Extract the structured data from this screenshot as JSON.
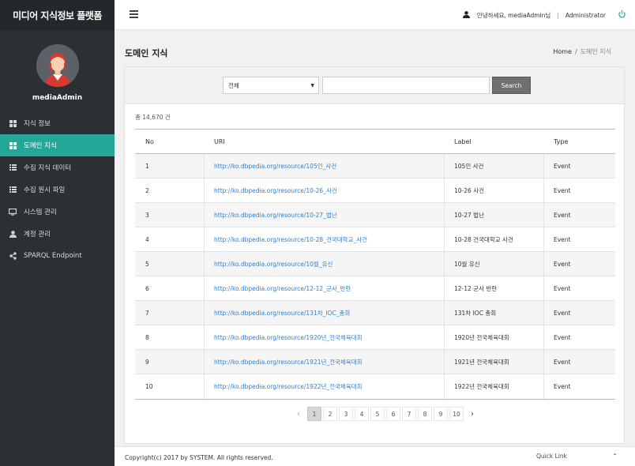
{
  "brand": "미디어 지식정보 플랫폼",
  "profile": {
    "name": "mediaAdmin"
  },
  "nav": [
    {
      "label": "지식 정보",
      "icon": "grid-icon"
    },
    {
      "label": "도메인 지식",
      "icon": "grid-icon",
      "active": true
    },
    {
      "label": "수집 지식 데이터",
      "icon": "list-icon"
    },
    {
      "label": "수집 원시 파일",
      "icon": "list-icon"
    },
    {
      "label": "시스템 관리",
      "icon": "monitor-icon"
    },
    {
      "label": "계정 관리",
      "icon": "user-icon"
    },
    {
      "label": "SPARQL Endpoint",
      "icon": "share-icon"
    }
  ],
  "topbar": {
    "greeting": "안녕하세요, mediaAdmin님",
    "separator": "|",
    "role": "Administrator"
  },
  "page": {
    "title": "도메인 지식",
    "breadcrumb_home": "Home",
    "breadcrumb_sep": "/",
    "breadcrumb_current": "도메인 지식"
  },
  "search": {
    "select_value": "전체",
    "input_value": "",
    "button_label": "Search"
  },
  "total": "총 14,670 건",
  "table": {
    "headers": {
      "no": "No",
      "uri": "URI",
      "label": "Label",
      "type": "Type"
    },
    "rows": [
      {
        "no": "1",
        "uri": "http://ko.dbpedia.org/resource/105인_사건",
        "label": "105인 사건",
        "type": "Event"
      },
      {
        "no": "2",
        "uri": "http://ko.dbpedia.org/resource/10-26_사건",
        "label": "10-26 사건",
        "type": "Event"
      },
      {
        "no": "3",
        "uri": "http://ko.dbpedia.org/resource/10-27_법난",
        "label": "10-27 법난",
        "type": "Event"
      },
      {
        "no": "4",
        "uri": "http://ko.dbpedia.org/resource/10-28_건국대학교_사건",
        "label": "10-28 건국대학교 사건",
        "type": "Event"
      },
      {
        "no": "5",
        "uri": "http://ko.dbpedia.org/resource/10월_유신",
        "label": "10월 유신",
        "type": "Event"
      },
      {
        "no": "6",
        "uri": "http://ko.dbpedia.org/resource/12-12_군사_반란",
        "label": "12-12 군사 반란",
        "type": "Event"
      },
      {
        "no": "7",
        "uri": "http://ko.dbpedia.org/resource/131차_IOC_총회",
        "label": "131차 IOC 총회",
        "type": "Event"
      },
      {
        "no": "8",
        "uri": "http://ko.dbpedia.org/resource/1920년_전국체육대회",
        "label": "1920년 전국체육대회",
        "type": "Event"
      },
      {
        "no": "9",
        "uri": "http://ko.dbpedia.org/resource/1921년_전국체육대회",
        "label": "1921년 전국체육대회",
        "type": "Event"
      },
      {
        "no": "10",
        "uri": "http://ko.dbpedia.org/resource/1922년_전국체육대회",
        "label": "1922년 전국체육대회",
        "type": "Event"
      }
    ]
  },
  "pagination": {
    "prev": "‹",
    "next": "›",
    "pages": [
      "1",
      "2",
      "3",
      "4",
      "5",
      "6",
      "7",
      "8",
      "9",
      "10"
    ],
    "current": "1"
  },
  "footer": {
    "copyright": "Copyright(c) 2017 by SYSTEM. All rights reserved.",
    "quicklink": "Quick Link",
    "caret": "⌃"
  },
  "colors": {
    "accent": "#23a797",
    "sidebar": "#2b3034",
    "link": "#2f7fd1"
  }
}
